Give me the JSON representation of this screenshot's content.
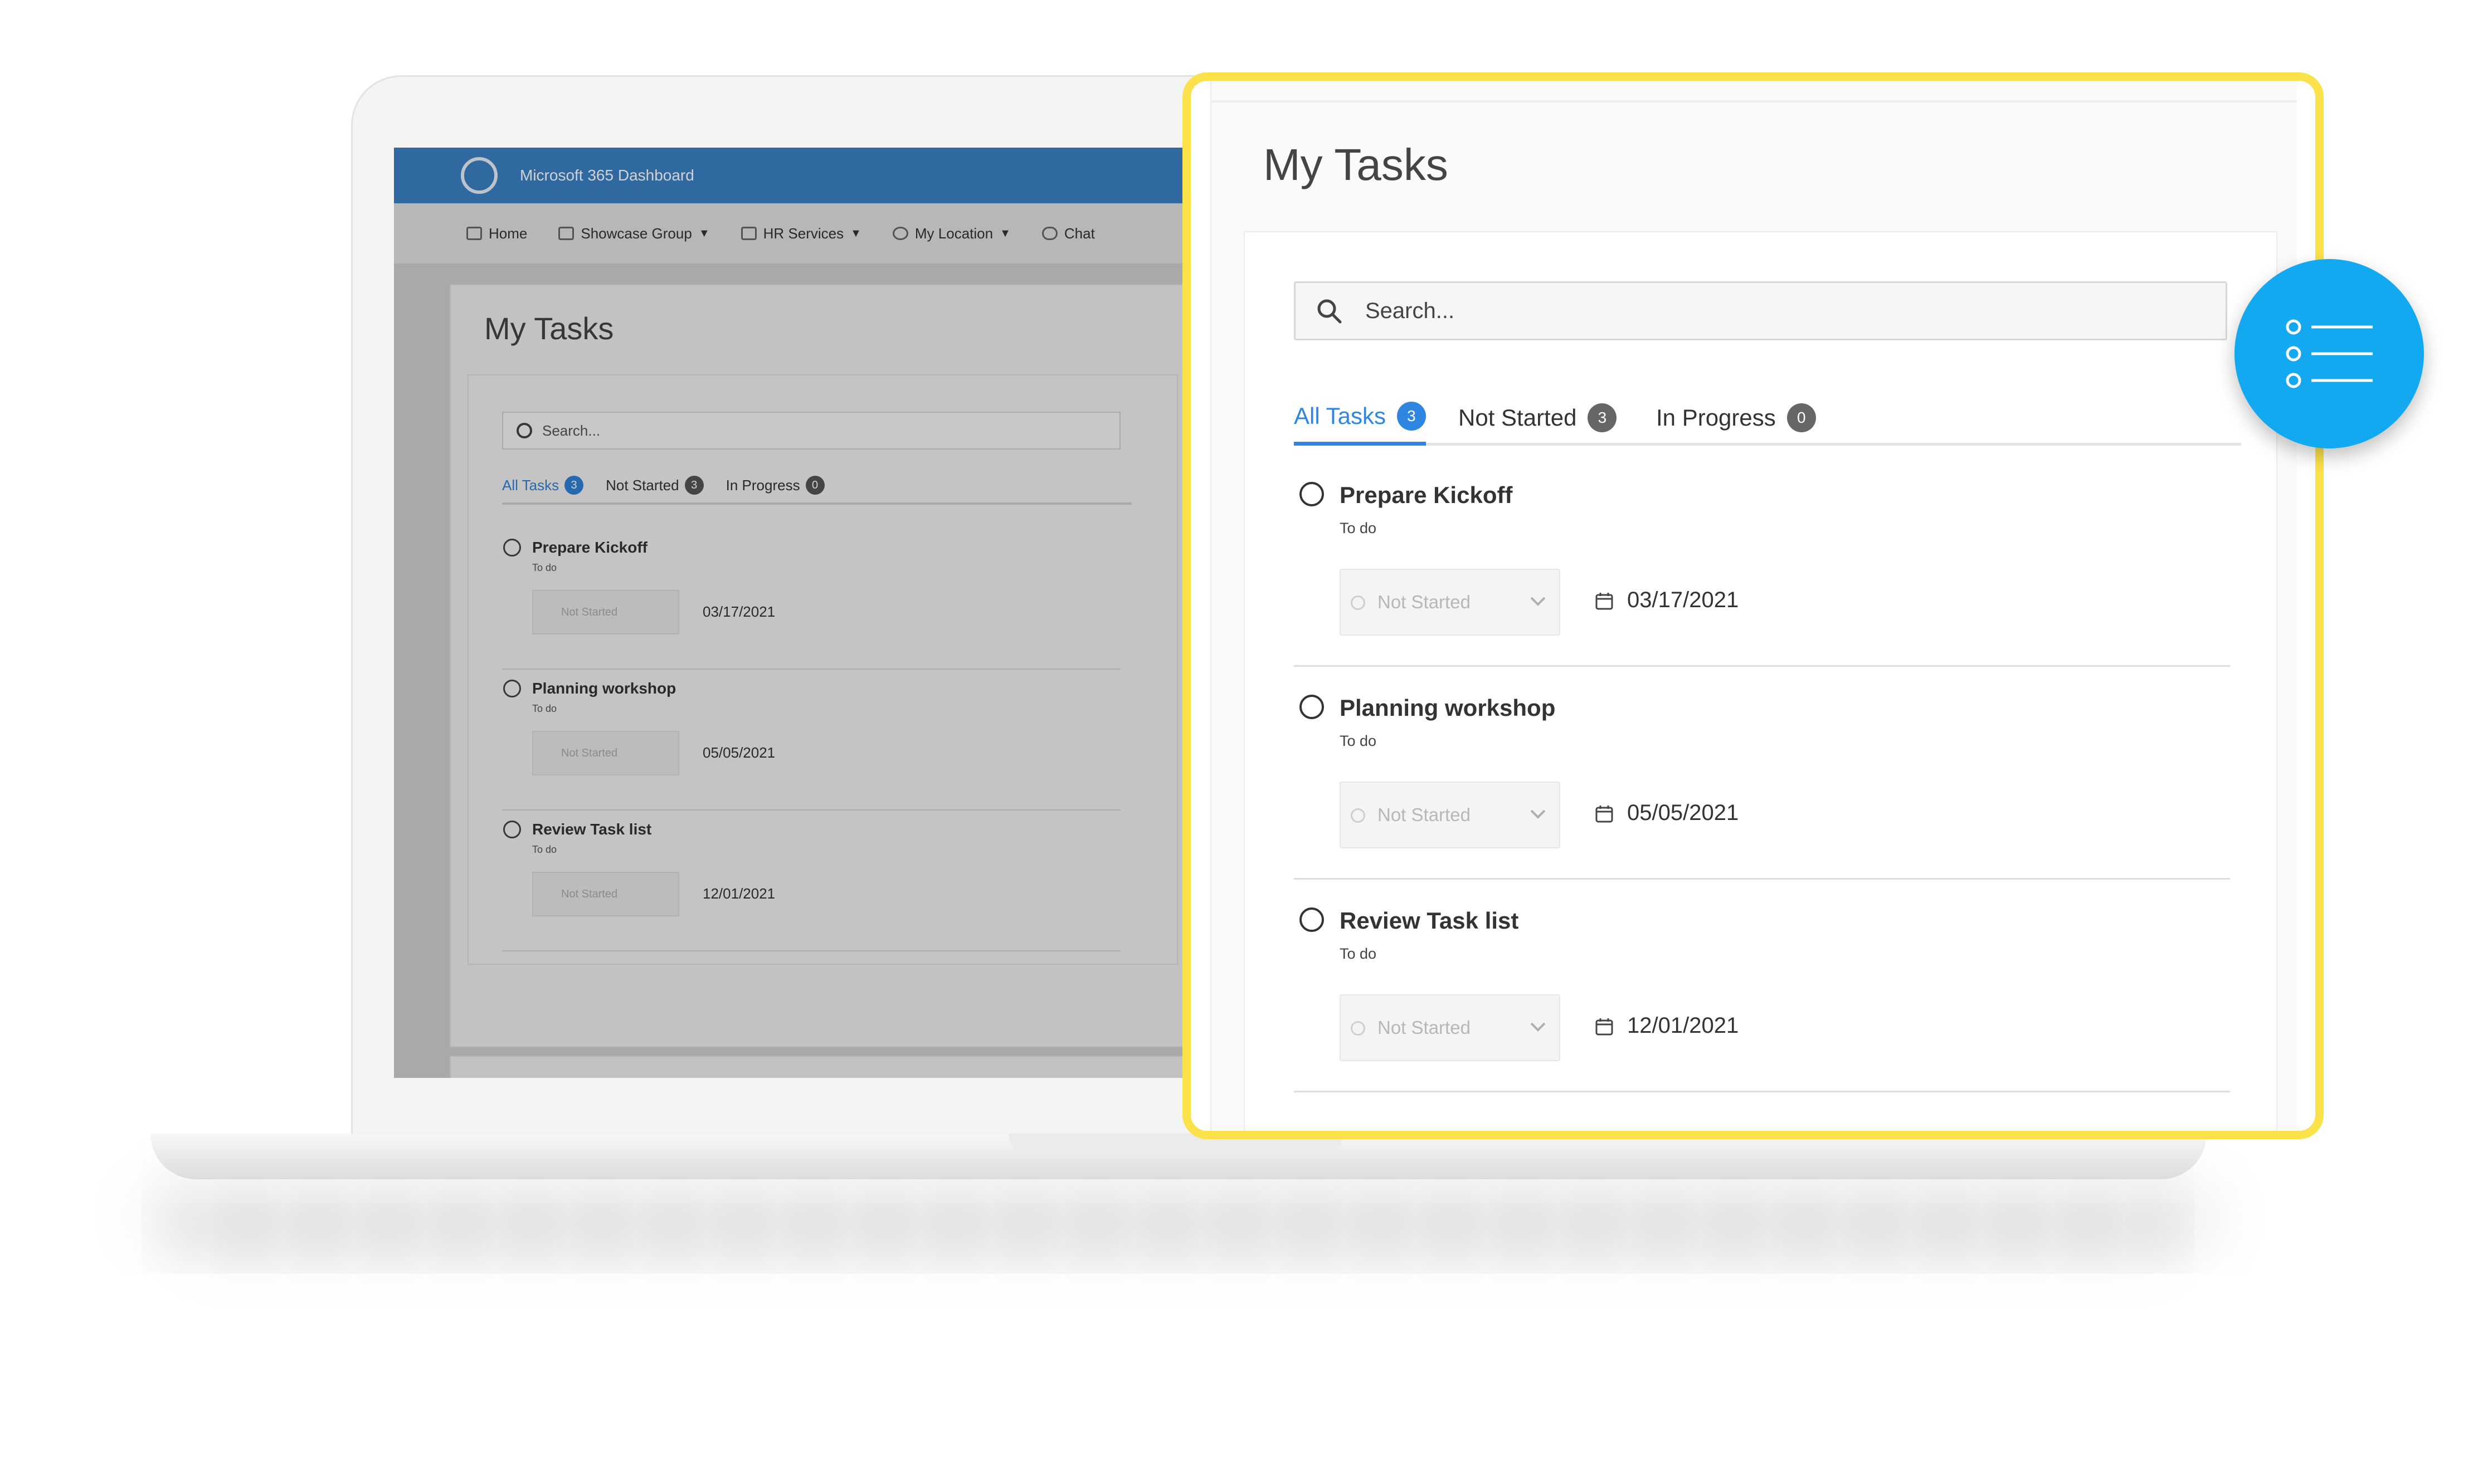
{
  "background_app": {
    "title": "Microsoft 365 Dashboard",
    "nav": [
      {
        "label": "Home",
        "icon": "home-icon",
        "has_caret": false
      },
      {
        "label": "Showcase Group",
        "icon": "building-icon",
        "has_caret": true
      },
      {
        "label": "HR Services",
        "icon": "folder-icon",
        "has_caret": true
      },
      {
        "label": "My Location",
        "icon": "globe-icon",
        "has_caret": true
      },
      {
        "label": "Chat",
        "icon": "chat-icon",
        "has_caret": false
      }
    ],
    "caret": "▼"
  },
  "tasks_panel": {
    "title": "My Tasks",
    "search_placeholder": "Search...",
    "tabs": [
      {
        "label": "All Tasks",
        "count": "3",
        "active": true
      },
      {
        "label": "Not Started",
        "count": "3",
        "active": false
      },
      {
        "label": "In Progress",
        "count": "0",
        "active": false
      }
    ],
    "tasks": [
      {
        "title": "Prepare Kickoff",
        "subtitle": "To do",
        "status": "Not Started",
        "date": "03/17/2021"
      },
      {
        "title": "Planning workshop",
        "subtitle": "To do",
        "status": "Not Started",
        "date": "05/05/2021"
      },
      {
        "title": "Review Task list",
        "subtitle": "To do",
        "status": "Not Started",
        "date": "12/01/2021"
      }
    ]
  },
  "colors": {
    "accent_blue": "#2f86e0",
    "appbar_blue": "#3b80c4",
    "highlight_yellow": "#fbe14a",
    "badge_bubble": "#12a9f0"
  }
}
